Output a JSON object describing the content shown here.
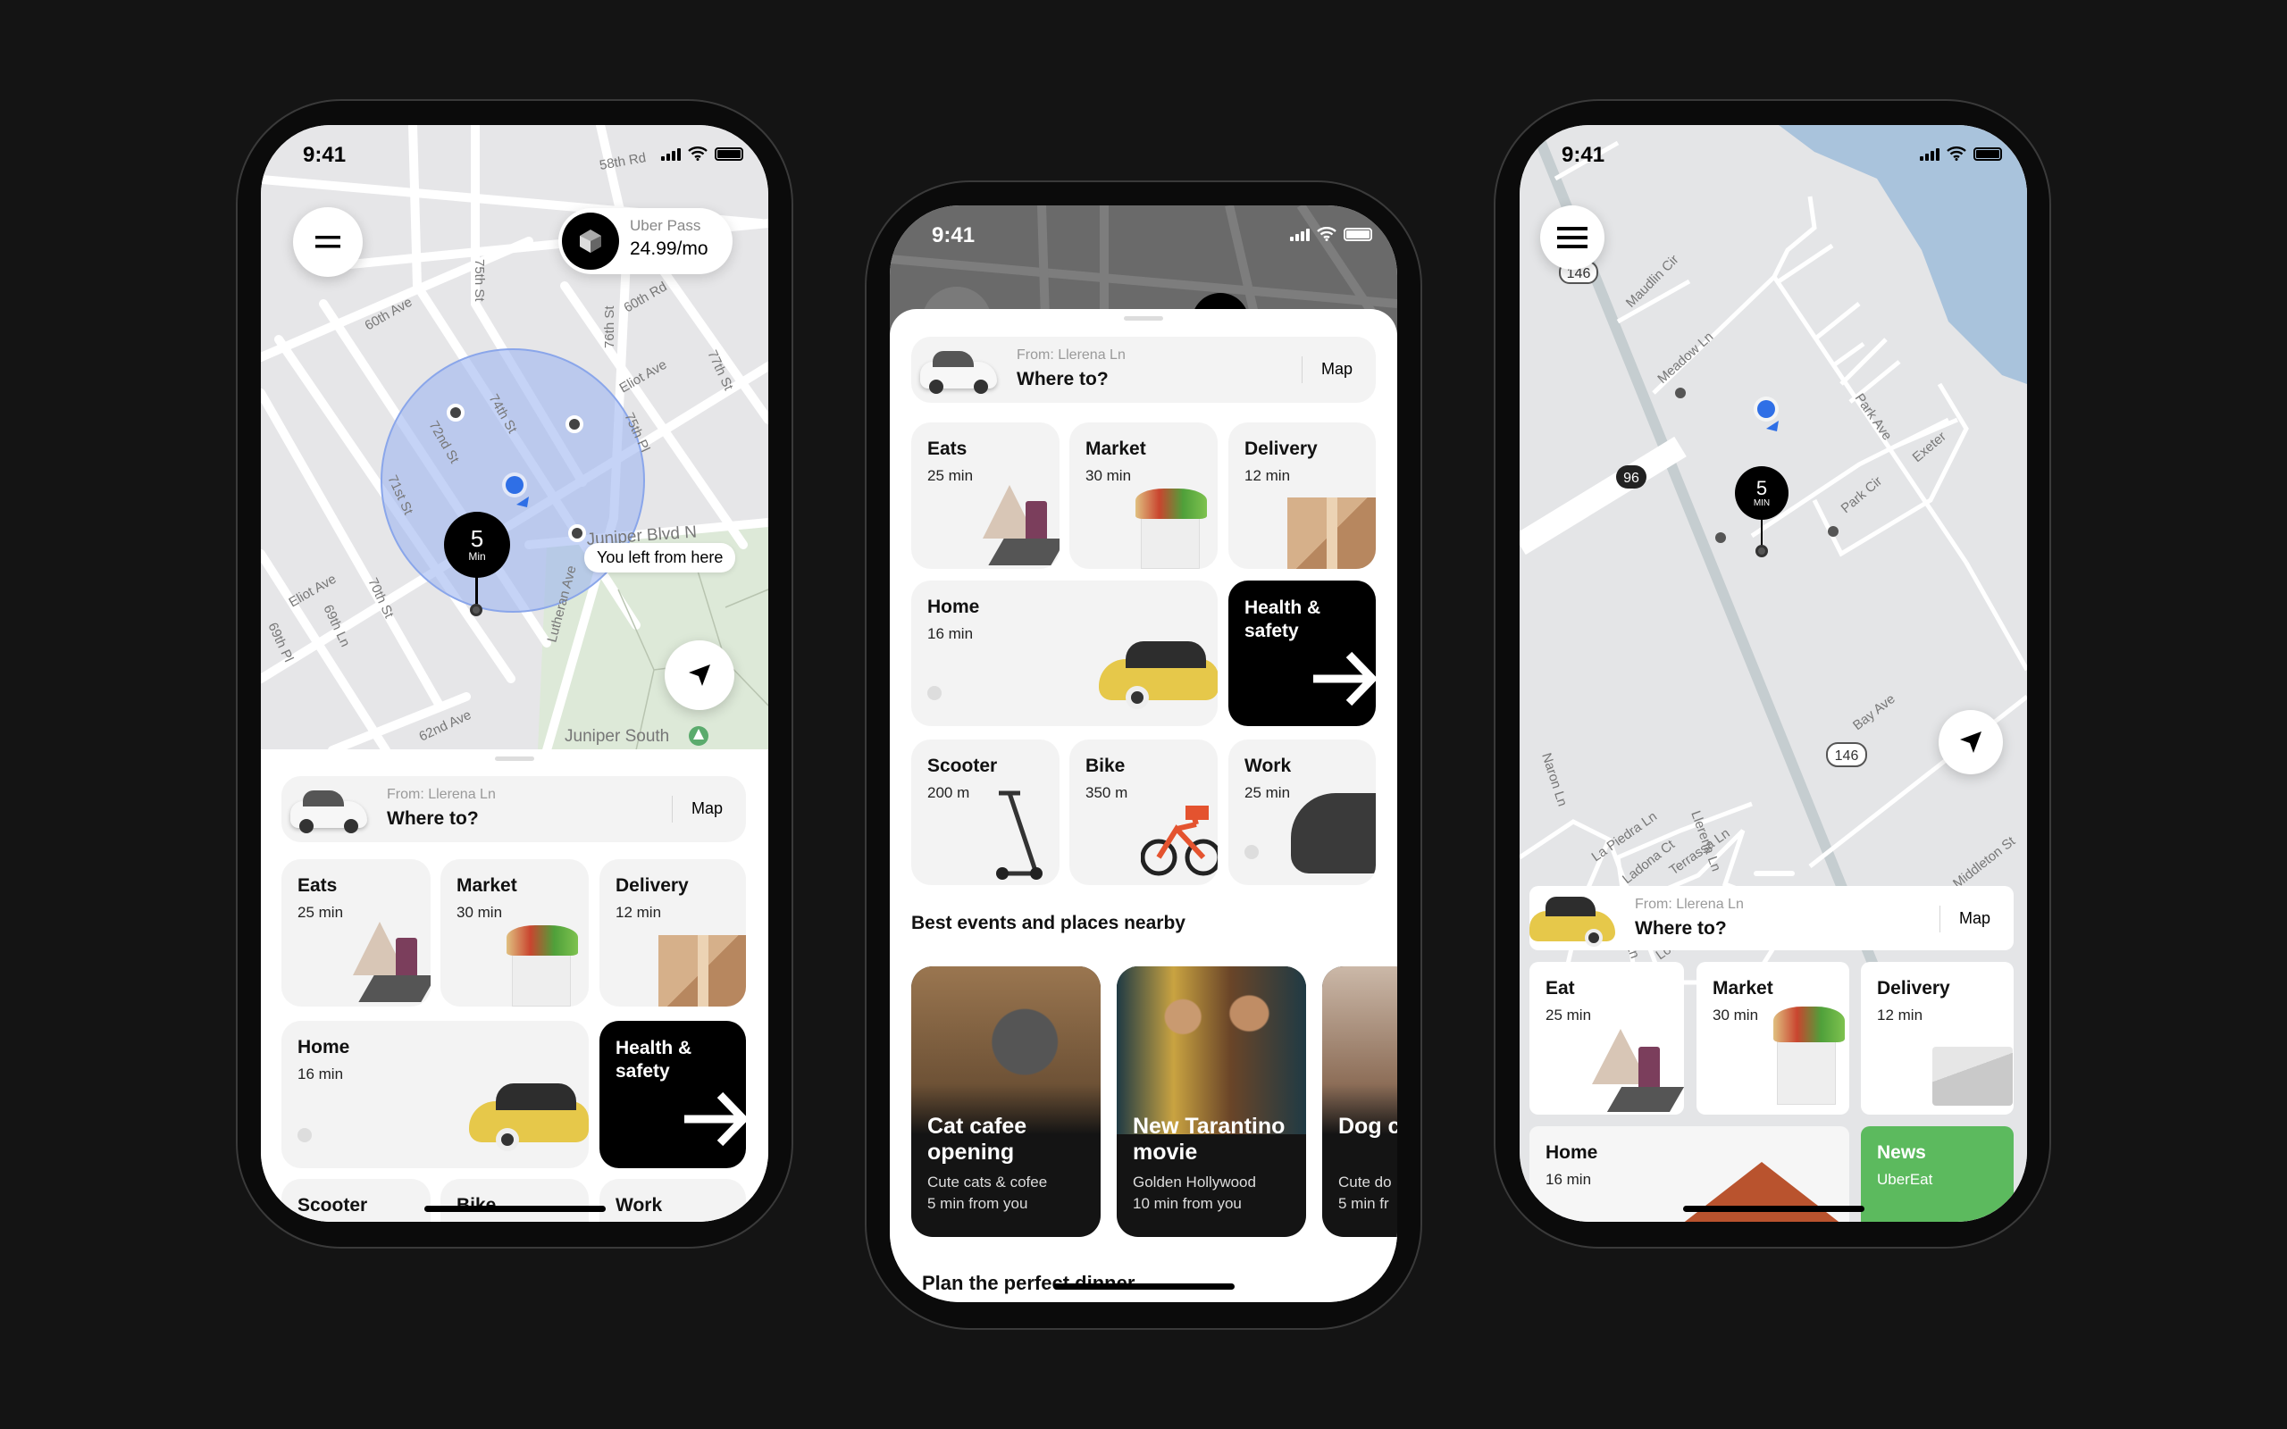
{
  "phones": [
    {
      "status": {
        "time": "9:41"
      },
      "uber_pass": {
        "label": "Uber Pass",
        "price": "24.99/mo"
      },
      "eta_pin": {
        "value": "5",
        "unit": "Min"
      },
      "tooltip": "You left from here",
      "map_labels": [
        "58th Rd",
        "60th Ave",
        "75th St",
        "60th Rd",
        "76th St",
        "Eliot Ave",
        "77th St",
        "74th St",
        "72nd St",
        "71st St",
        "75th Pl",
        "Juniper Blvd N",
        "Lutheran Ave",
        "Eliot Ave",
        "69th Ln",
        "70th St",
        "69th Pl",
        "62nd Ave",
        "Juniper South"
      ],
      "search": {
        "from": "From: Llerena Ln",
        "placeholder": "Where to?",
        "map": "Map"
      },
      "tiles": [
        {
          "title": "Eats",
          "sub": "25 min"
        },
        {
          "title": "Market",
          "sub": "30 min"
        },
        {
          "title": "Delivery",
          "sub": "12 min"
        },
        {
          "title": "Home",
          "sub": "16 min"
        },
        {
          "title": "Health & safety"
        },
        {
          "title": "Scooter"
        },
        {
          "title": "Bike"
        },
        {
          "title": "Work"
        }
      ]
    },
    {
      "status": {
        "time": "9:41"
      },
      "search": {
        "from": "From: Llerena Ln",
        "placeholder": "Where to?",
        "map": "Map"
      },
      "tiles": [
        {
          "title": "Eats",
          "sub": "25 min"
        },
        {
          "title": "Market",
          "sub": "30 min"
        },
        {
          "title": "Delivery",
          "sub": "12 min"
        },
        {
          "title": "Home",
          "sub": "16 min"
        },
        {
          "title": "Health & safety"
        },
        {
          "title": "Scooter",
          "sub": "200 m"
        },
        {
          "title": "Bike",
          "sub": "350 m"
        },
        {
          "title": "Work",
          "sub": "25 min"
        }
      ],
      "events_title": "Best events and places nearby",
      "events": [
        {
          "title": "Cat cafee opening",
          "desc": "Cute cats & cofee",
          "distance": "5 min from you"
        },
        {
          "title": "New Tarantino movie",
          "desc": "Golden Hollywood",
          "distance": "10 min from you"
        },
        {
          "title": "Dog c openi",
          "desc": "Cute do",
          "distance": "5 min fr"
        }
      ],
      "next_section_title": "Plan the perfect dinner"
    },
    {
      "status": {
        "time": "9:41"
      },
      "eta_pin": {
        "value": "5",
        "unit": "MIN"
      },
      "map_labels": [
        "Maudlin Cir",
        "Meadow Ln",
        "Park Ave",
        "Park Cir",
        "Exeter",
        "La Piedra Ln",
        "Ladona Ct",
        "Llerena Ln",
        "Lisboa Ln",
        "Loures Ln",
        "Naron Ln",
        "Terrassa Ln",
        "Bay Ave",
        "Middleton St"
      ],
      "road_shields": [
        "146",
        "96",
        "146"
      ],
      "search": {
        "from": "From: Llerena Ln",
        "placeholder": "Where to?",
        "map": "Map"
      },
      "tiles": [
        {
          "title": "Eat",
          "sub": "25 min"
        },
        {
          "title": "Market",
          "sub": "30 min"
        },
        {
          "title": "Delivery",
          "sub": "12 min"
        },
        {
          "title": "Home",
          "sub": "16 min"
        },
        {
          "title": "News",
          "sub": "UberEat"
        }
      ]
    }
  ],
  "colors": {
    "background": "#141414",
    "location_blue": "#2f6fe6",
    "news_green": "#5cba5e",
    "water": "#a9c3dc",
    "park": "#dde9d8"
  }
}
